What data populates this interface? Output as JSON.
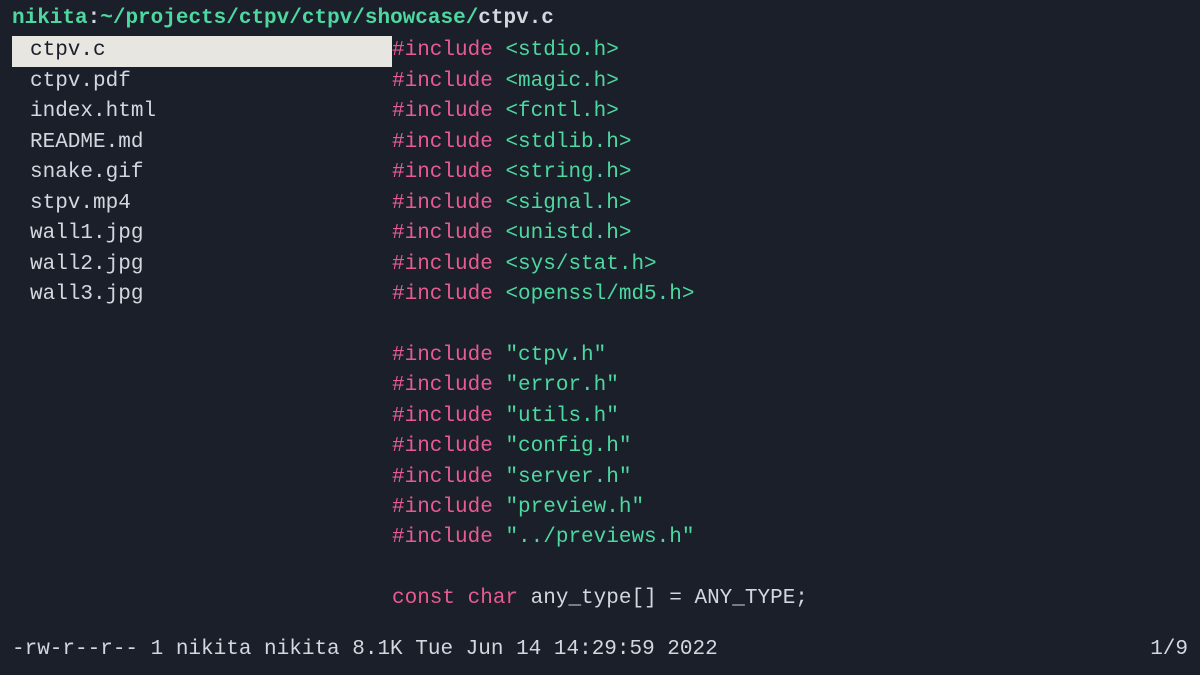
{
  "header": {
    "user": "nikita",
    "separator": ":",
    "path_prefix": "~/projects/ctpv/ctpv/showcase/",
    "current_file": "ctpv.c"
  },
  "files": [
    {
      "name": "ctpv.c",
      "selected": true
    },
    {
      "name": "ctpv.pdf",
      "selected": false
    },
    {
      "name": "index.html",
      "selected": false
    },
    {
      "name": "README.md",
      "selected": false
    },
    {
      "name": "snake.gif",
      "selected": false
    },
    {
      "name": "stpv.mp4",
      "selected": false
    },
    {
      "name": "wall1.jpg",
      "selected": false
    },
    {
      "name": "wall2.jpg",
      "selected": false
    },
    {
      "name": "wall3.jpg",
      "selected": false
    }
  ],
  "code_lines": [
    {
      "tokens": [
        {
          "t": "kw",
          "v": "#include"
        },
        {
          "t": "plain",
          "v": " "
        },
        {
          "t": "hdr",
          "v": "<stdio.h>"
        }
      ]
    },
    {
      "tokens": [
        {
          "t": "kw",
          "v": "#include"
        },
        {
          "t": "plain",
          "v": " "
        },
        {
          "t": "hdr",
          "v": "<magic.h>"
        }
      ]
    },
    {
      "tokens": [
        {
          "t": "kw",
          "v": "#include"
        },
        {
          "t": "plain",
          "v": " "
        },
        {
          "t": "hdr",
          "v": "<fcntl.h>"
        }
      ]
    },
    {
      "tokens": [
        {
          "t": "kw",
          "v": "#include"
        },
        {
          "t": "plain",
          "v": " "
        },
        {
          "t": "hdr",
          "v": "<stdlib.h>"
        }
      ]
    },
    {
      "tokens": [
        {
          "t": "kw",
          "v": "#include"
        },
        {
          "t": "plain",
          "v": " "
        },
        {
          "t": "hdr",
          "v": "<string.h>"
        }
      ]
    },
    {
      "tokens": [
        {
          "t": "kw",
          "v": "#include"
        },
        {
          "t": "plain",
          "v": " "
        },
        {
          "t": "hdr",
          "v": "<signal.h>"
        }
      ]
    },
    {
      "tokens": [
        {
          "t": "kw",
          "v": "#include"
        },
        {
          "t": "plain",
          "v": " "
        },
        {
          "t": "hdr",
          "v": "<unistd.h>"
        }
      ]
    },
    {
      "tokens": [
        {
          "t": "kw",
          "v": "#include"
        },
        {
          "t": "plain",
          "v": " "
        },
        {
          "t": "hdr",
          "v": "<sys/stat.h>"
        }
      ]
    },
    {
      "tokens": [
        {
          "t": "kw",
          "v": "#include"
        },
        {
          "t": "plain",
          "v": " "
        },
        {
          "t": "hdr",
          "v": "<openssl/md5.h>"
        }
      ]
    },
    {
      "tokens": [
        {
          "t": "plain",
          "v": ""
        }
      ]
    },
    {
      "tokens": [
        {
          "t": "kw",
          "v": "#include"
        },
        {
          "t": "plain",
          "v": " "
        },
        {
          "t": "hdr",
          "v": "\"ctpv.h\""
        }
      ]
    },
    {
      "tokens": [
        {
          "t": "kw",
          "v": "#include"
        },
        {
          "t": "plain",
          "v": " "
        },
        {
          "t": "hdr",
          "v": "\"error.h\""
        }
      ]
    },
    {
      "tokens": [
        {
          "t": "kw",
          "v": "#include"
        },
        {
          "t": "plain",
          "v": " "
        },
        {
          "t": "hdr",
          "v": "\"utils.h\""
        }
      ]
    },
    {
      "tokens": [
        {
          "t": "kw",
          "v": "#include"
        },
        {
          "t": "plain",
          "v": " "
        },
        {
          "t": "hdr",
          "v": "\"config.h\""
        }
      ]
    },
    {
      "tokens": [
        {
          "t": "kw",
          "v": "#include"
        },
        {
          "t": "plain",
          "v": " "
        },
        {
          "t": "hdr",
          "v": "\"server.h\""
        }
      ]
    },
    {
      "tokens": [
        {
          "t": "kw",
          "v": "#include"
        },
        {
          "t": "plain",
          "v": " "
        },
        {
          "t": "hdr",
          "v": "\"preview.h\""
        }
      ]
    },
    {
      "tokens": [
        {
          "t": "kw",
          "v": "#include"
        },
        {
          "t": "plain",
          "v": " "
        },
        {
          "t": "hdr",
          "v": "\"../previews.h\""
        }
      ]
    },
    {
      "tokens": [
        {
          "t": "plain",
          "v": ""
        }
      ]
    },
    {
      "tokens": [
        {
          "t": "kw",
          "v": "const"
        },
        {
          "t": "plain",
          "v": " "
        },
        {
          "t": "kw",
          "v": "char"
        },
        {
          "t": "plain",
          "v": " any_type[] = ANY_TYPE;"
        }
      ]
    }
  ],
  "status": {
    "left": "-rw-r--r-- 1 nikita nikita 8.1K Tue Jun 14 14:29:59 2022",
    "right": "1/9"
  }
}
